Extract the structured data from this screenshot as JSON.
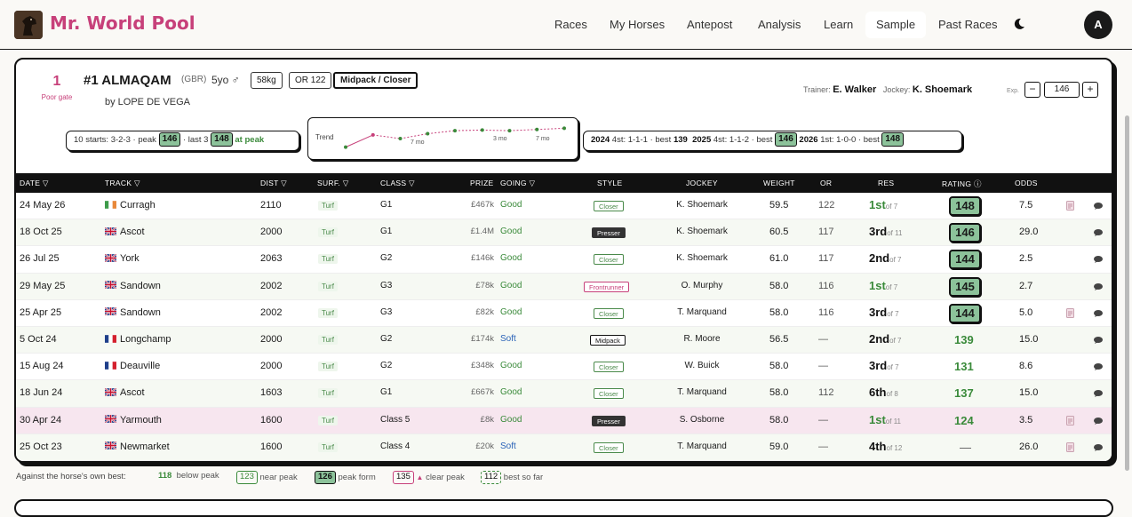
{
  "app": {
    "brand": "Mr. World Pool",
    "avatar_initial": "A"
  },
  "nav": [
    {
      "label": "Races",
      "active": false
    },
    {
      "label": "My Horses",
      "active": false
    },
    {
      "label": "Antepost",
      "active": false
    },
    {
      "label": "Analysis",
      "active": false
    },
    {
      "label": "Learn",
      "active": false
    },
    {
      "label": "Sample",
      "active": true
    },
    {
      "label": "Past Races",
      "active": false
    }
  ],
  "horse": {
    "draw": "1",
    "draw_label": "Poor gate",
    "name": "#1 ALMAQAM",
    "country": "(GBR)",
    "age_sex": "5yo ♂",
    "weight": "58kg",
    "or": "OR 122",
    "style": "Midpack / Closer",
    "sire": "by LOPE DE VEGA",
    "trainer_label": "Trainer:",
    "trainer": "E. Walker",
    "jockey_label": "Jockey:",
    "jockey": "K. Shoemark",
    "exp_label": "Exp.",
    "exp_value": "146",
    "minus": "−",
    "plus": "+"
  },
  "summary": {
    "starts": "10 starts: 3-2-3",
    "peak_label": "· peak",
    "peak": "146",
    "last3_label": "· last 3",
    "last3": "148",
    "at_peak": "at peak"
  },
  "trend": {
    "label": "Trend",
    "gaps": [
      "7 mo",
      "3 mo",
      "7 mo"
    ],
    "points": [
      117,
      137,
      131,
      139,
      144,
      145,
      144,
      146,
      148
    ]
  },
  "seasons": [
    {
      "year": "2024",
      "record": "4st: 1-1-1",
      "best_label": "· best",
      "best": "139",
      "badge": false
    },
    {
      "year": "2025",
      "record": "4st: 1-1-2",
      "best_label": "· best",
      "best": "146",
      "badge": true
    },
    {
      "year": "2026",
      "record": "1st: 1-0-0",
      "best_label": "· best",
      "best": "148",
      "badge": true
    }
  ],
  "columns": {
    "date": "DATE ▽",
    "track": "TRACK ▽",
    "dist": "DIST ▽",
    "surf": "SURF. ▽",
    "class": "CLASS ▽",
    "prize": "PRIZE",
    "going": "GOING ▽",
    "style": "STYLE",
    "jockey": "JOCKEY",
    "weight": "WEIGHT",
    "or": "OR",
    "res": "RES",
    "rating": "RATING ⓘ",
    "odds": "ODDS"
  },
  "rows": [
    {
      "date": "24 May 26",
      "flag": "ie",
      "track": "Curragh",
      "dist": "2110",
      "surf": "Turf",
      "class": "G1",
      "prize": "£467k",
      "going": "Good",
      "style": "Closer",
      "jockey": "K. Shoemark",
      "weight": "59.5",
      "or": "122",
      "res": "1st",
      "of": "of 7",
      "rating": "148",
      "rating_box": true,
      "odds": "7.5",
      "note": true
    },
    {
      "date": "18 Oct 25",
      "flag": "gb",
      "track": "Ascot",
      "dist": "2000",
      "surf": "Turf",
      "class": "G1",
      "prize": "£1.4M",
      "going": "Good",
      "style": "Presser",
      "jockey": "K. Shoemark",
      "weight": "60.5",
      "or": "117",
      "res": "3rd",
      "of": "of 11",
      "rating": "146",
      "rating_box": true,
      "odds": "29.0",
      "note": false
    },
    {
      "date": "26 Jul 25",
      "flag": "gb",
      "track": "York",
      "dist": "2063",
      "surf": "Turf",
      "class": "G2",
      "prize": "£146k",
      "going": "Good",
      "style": "Closer",
      "jockey": "K. Shoemark",
      "weight": "61.0",
      "or": "117",
      "res": "2nd",
      "of": "of 7",
      "rating": "144",
      "rating_box": true,
      "odds": "2.5",
      "note": false
    },
    {
      "date": "29 May 25",
      "flag": "gb",
      "track": "Sandown",
      "dist": "2002",
      "surf": "Turf",
      "class": "G3",
      "prize": "£78k",
      "going": "Good",
      "style": "Frontrunner",
      "jockey": "O. Murphy",
      "weight": "58.0",
      "or": "116",
      "res": "1st",
      "of": "of 7",
      "rating": "145",
      "rating_box": true,
      "odds": "2.7",
      "note": false
    },
    {
      "date": "25 Apr 25",
      "flag": "gb",
      "track": "Sandown",
      "dist": "2002",
      "surf": "Turf",
      "class": "G3",
      "prize": "£82k",
      "going": "Good",
      "style": "Closer",
      "jockey": "T. Marquand",
      "weight": "58.0",
      "or": "116",
      "res": "3rd",
      "of": "of 7",
      "rating": "144",
      "rating_box": true,
      "odds": "5.0",
      "note": true
    },
    {
      "date": "5 Oct 24",
      "flag": "fr",
      "track": "Longchamp",
      "dist": "2000",
      "surf": "Turf",
      "class": "G2",
      "prize": "£174k",
      "going": "Soft",
      "style": "Midpack",
      "jockey": "R. Moore",
      "weight": "56.5",
      "or": "—",
      "res": "2nd",
      "of": "of 7",
      "rating": "139",
      "rating_box": false,
      "odds": "15.0",
      "note": false
    },
    {
      "date": "15 Aug 24",
      "flag": "fr",
      "track": "Deauville",
      "dist": "2000",
      "surf": "Turf",
      "class": "G2",
      "prize": "£348k",
      "going": "Good",
      "style": "Closer",
      "jockey": "W. Buick",
      "weight": "58.0",
      "or": "—",
      "res": "3rd",
      "of": "of 7",
      "rating": "131",
      "rating_box": false,
      "odds": "8.6",
      "note": false
    },
    {
      "date": "18 Jun 24",
      "flag": "gb",
      "track": "Ascot",
      "dist": "1603",
      "surf": "Turf",
      "class": "G1",
      "prize": "£667k",
      "going": "Good",
      "style": "Closer",
      "jockey": "T. Marquand",
      "weight": "58.0",
      "or": "112",
      "res": "6th",
      "of": "of 8",
      "rating": "137",
      "rating_box": false,
      "odds": "15.0",
      "note": false
    },
    {
      "date": "30 Apr 24",
      "flag": "gb",
      "track": "Yarmouth",
      "dist": "1600",
      "surf": "Turf",
      "class": "Class 5",
      "prize": "£8k",
      "going": "Good",
      "style": "Presser",
      "jockey": "S. Osborne",
      "weight": "58.0",
      "or": "—",
      "res": "1st",
      "of": "of 11",
      "rating": "124",
      "rating_box": false,
      "odds": "3.5",
      "note": true
    },
    {
      "date": "25 Oct 23",
      "flag": "gb",
      "track": "Newmarket",
      "dist": "1600",
      "surf": "Turf",
      "class": "Class 4",
      "prize": "£20k",
      "going": "Soft",
      "style": "Closer",
      "jockey": "T. Marquand",
      "weight": "59.0",
      "or": "—",
      "res": "4th",
      "of": "of 12",
      "rating": "—",
      "rating_box": false,
      "odds": "26.0",
      "note": true
    }
  ],
  "legend": {
    "title": "Against the horse's own best:",
    "below_val": "118",
    "below_lbl": "below peak",
    "near_val": "123",
    "near_lbl": "near peak",
    "peak_val": "126",
    "peak_lbl": "peak form",
    "clear_val": "135",
    "clear_lbl": "clear peak",
    "best_val": "112",
    "best_lbl": "best so far"
  }
}
